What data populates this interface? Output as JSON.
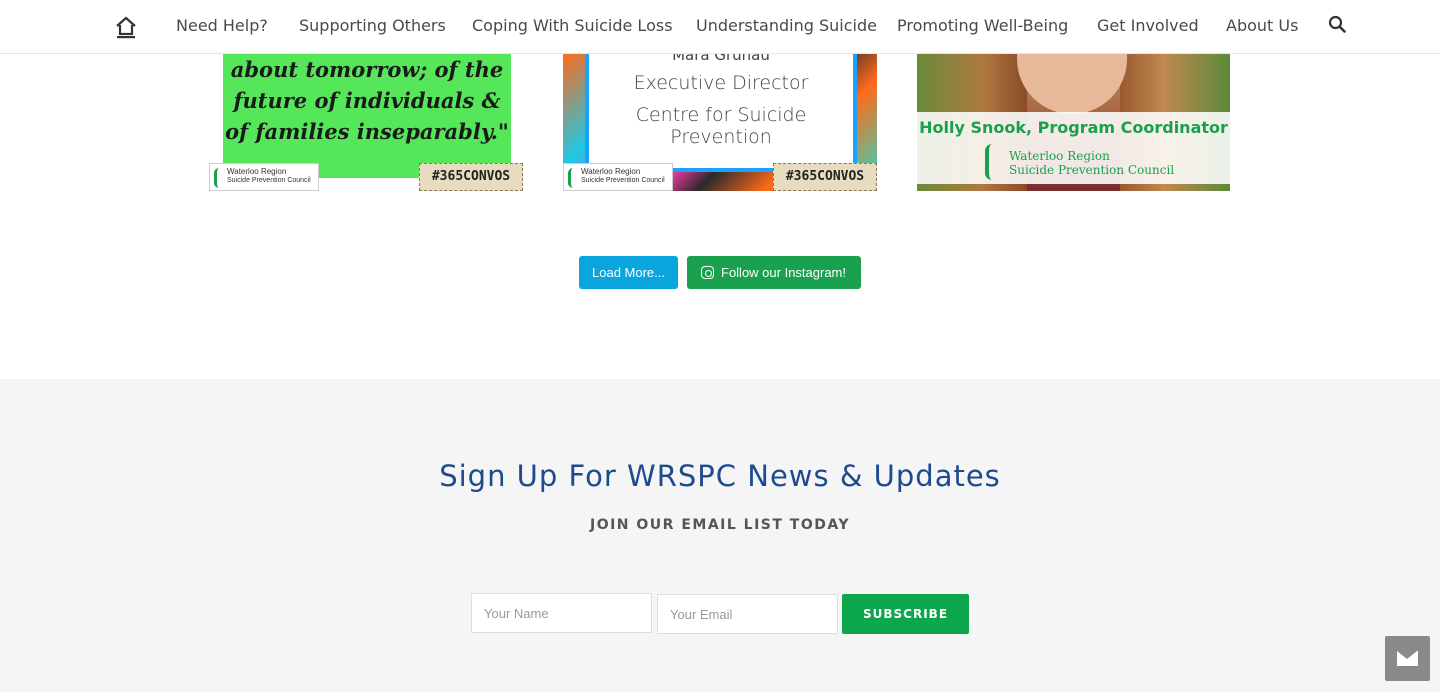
{
  "nav": {
    "items": [
      "Need Help?",
      "Supporting Others",
      "Coping With Suicide Loss",
      "Understanding Suicide",
      "Promoting Well-Being",
      "Get Involved",
      "About Us"
    ]
  },
  "instagram": {
    "tiles": [
      {
        "quote_lines": [
          "about tomorrow; of the",
          "future of individuals &",
          "of families inseparably.\""
        ],
        "logo_line1": "Waterloo Region",
        "logo_line2": "Suicide Prevention Council",
        "hashtag": "#365CONVOS"
      },
      {
        "lines": [
          "Mara Grunau",
          "Executive Director",
          "Centre for Suicide Prevention"
        ],
        "logo_line1": "Waterloo Region",
        "logo_line2": "Suicide Prevention Council",
        "hashtag": "#365CONVOS"
      },
      {
        "name": "Holly Snook, Program Coordinator",
        "org_line1": "Waterloo Region",
        "org_line2": "Suicide Prevention Council"
      }
    ],
    "load_more_label": "Load More...",
    "follow_label": "Follow our Instagram!"
  },
  "signup": {
    "title": "Sign Up For WRSPC News & Updates",
    "subtitle": "JOIN OUR EMAIL LIST TODAY",
    "name_placeholder": "Your Name",
    "email_placeholder": "Your Email",
    "subscribe_label": "SUBSCRIBE"
  },
  "colors": {
    "brand_blue": "#1e4a8e",
    "brand_green": "#1aa150",
    "load_more_blue": "#0aa5dd"
  }
}
